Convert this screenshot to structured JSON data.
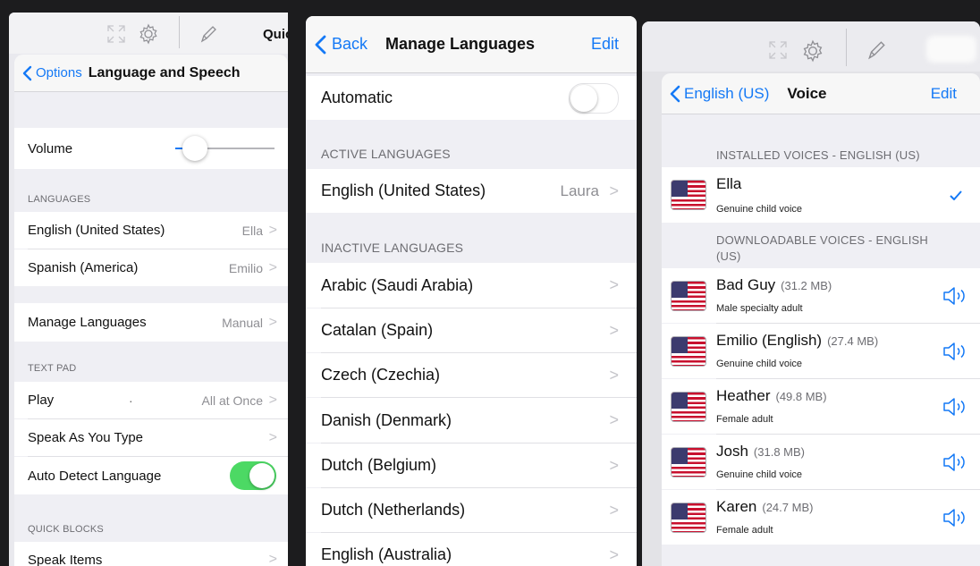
{
  "colors": {
    "accent": "#1479f6",
    "switch_on": "#4cd964"
  },
  "panel1": {
    "toolbar_partial_title": "Quic",
    "back_label": "Options",
    "title": "Language and Speech",
    "volume_label": "Volume",
    "volume_level": 0.2,
    "languages_header": "LANGUAGES",
    "languages": [
      {
        "name": "English (United States)",
        "voice": "Ella"
      },
      {
        "name": "Spanish (America)",
        "voice": "Emilio"
      }
    ],
    "manage_label": "Manage Languages",
    "manage_value": "Manual",
    "textpad_header": "TEXT PAD",
    "play_label": "Play",
    "play_value": "All at Once",
    "play_dot": "·",
    "speak_as_you_type": "Speak As You Type",
    "auto_detect_label": "Auto Detect Language",
    "auto_detect_on": true,
    "quick_blocks_header": "QUICK BLOCKS",
    "speak_items": "Speak Items"
  },
  "panel2": {
    "back_label": "Back",
    "title": "Manage Languages",
    "edit_label": "Edit",
    "automatic_label": "Automatic",
    "automatic_on": false,
    "active_header": "ACTIVE LANGUAGES",
    "active": [
      {
        "name": "English (United States)",
        "voice": "Laura"
      }
    ],
    "inactive_header": "INACTIVE LANGUAGES",
    "inactive": [
      "Arabic (Saudi Arabia)",
      "Catalan (Spain)",
      "Czech (Czechia)",
      "Danish (Denmark)",
      "Dutch (Belgium)",
      "Dutch (Netherlands)",
      "English (Australia)"
    ]
  },
  "panel3": {
    "back_label": "English (US)",
    "title": "Voice",
    "edit_label": "Edit",
    "installed_header": "INSTALLED VOICES - ENGLISH (US)",
    "installed": [
      {
        "name": "Ella",
        "desc": "Genuine child voice",
        "selected": true
      }
    ],
    "downloadable_header_line1": "DOWNLOADABLE VOICES - ENGLISH",
    "downloadable_header_line2": "(US)",
    "downloadable": [
      {
        "name": "Bad Guy",
        "size": "(31.2 MB)",
        "desc": "Male specialty adult"
      },
      {
        "name": "Emilio (English)",
        "size": "(27.4 MB)",
        "desc": "Genuine child voice"
      },
      {
        "name": "Heather",
        "size": "(49.8 MB)",
        "desc": "Female adult"
      },
      {
        "name": "Josh",
        "size": "(31.8 MB)",
        "desc": "Genuine child voice"
      },
      {
        "name": "Karen",
        "size": "(24.7 MB)",
        "desc": "Female adult"
      }
    ]
  }
}
